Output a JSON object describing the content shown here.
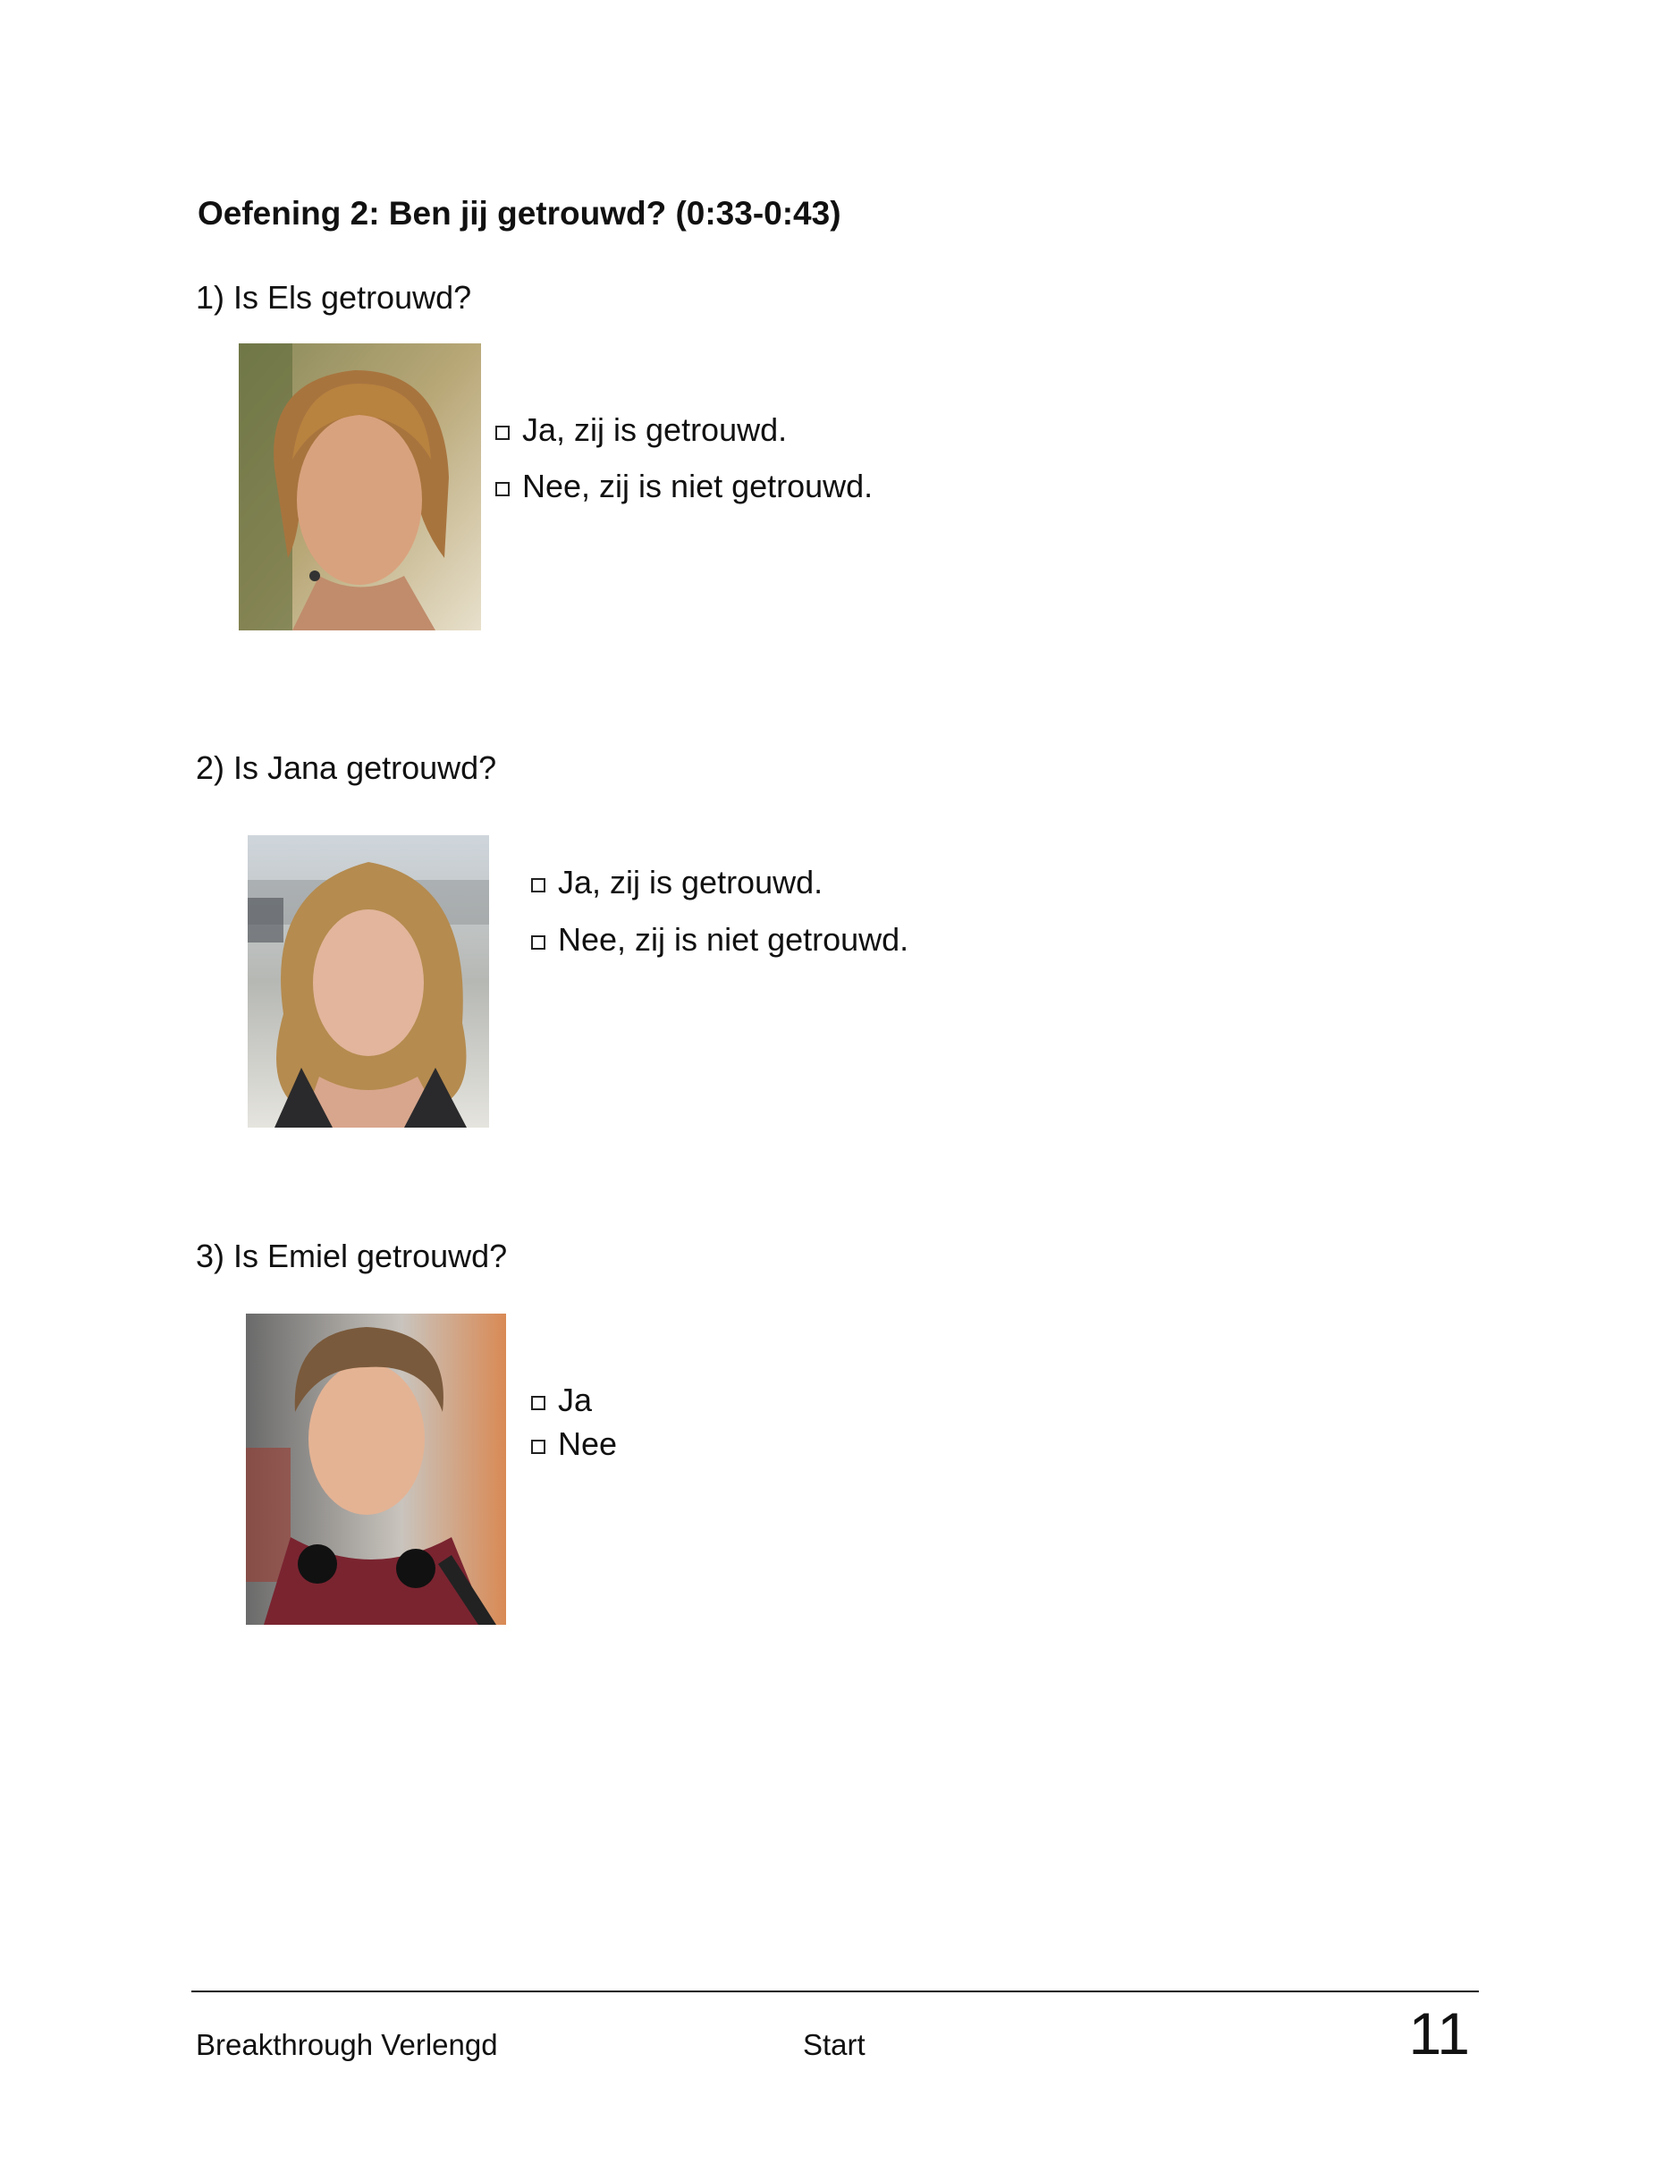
{
  "exercise": {
    "title": "Oefening 2: Ben jij getrouwd? (0:33-0:43)"
  },
  "questions": [
    {
      "label": "1) Is Els getrouwd?",
      "options": [
        "Ja, zij is getrouwd.",
        "Nee, zij is niet getrouwd."
      ]
    },
    {
      "label": "2) Is Jana getrouwd?",
      "options": [
        "Ja, zij is getrouwd.",
        "Nee, zij is niet getrouwd."
      ]
    },
    {
      "label": "3) Is Emiel getrouwd?",
      "options": [
        "Ja",
        "Nee"
      ]
    }
  ],
  "footer": {
    "left": "Breakthrough Verlengd",
    "center": "Start",
    "page_number": "11"
  }
}
